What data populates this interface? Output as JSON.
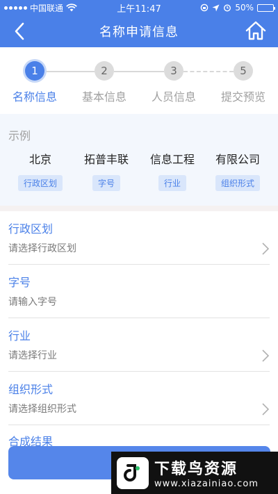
{
  "status_bar": {
    "carrier": "中国联通",
    "time": "上午11:47",
    "battery": "50%",
    "battery_level": 0.5
  },
  "nav": {
    "title": "名称申请信息",
    "back_icon": "chevron-left-icon",
    "home_icon": "home-icon"
  },
  "steps": [
    {
      "number": "1",
      "label": "名称信息",
      "active": true
    },
    {
      "number": "2",
      "label": "基本信息",
      "active": false
    },
    {
      "number": "3",
      "label": "人员信息",
      "active": false
    },
    {
      "number": "5",
      "label": "提交预览",
      "active": false
    }
  ],
  "example": {
    "title": "示例",
    "parts": [
      {
        "word": "北京",
        "tag": "行政区划"
      },
      {
        "word": "拓普丰联",
        "tag": "字号"
      },
      {
        "word": "信息工程",
        "tag": "行业"
      },
      {
        "word": "有限公司",
        "tag": "组织形式"
      }
    ]
  },
  "form": {
    "fields": [
      {
        "label": "行政区划",
        "placeholder": "请选择行政区划",
        "type": "select"
      },
      {
        "label": "字号",
        "placeholder": "请输入字号",
        "type": "input"
      },
      {
        "label": "行业",
        "placeholder": "请选择行业",
        "type": "select"
      },
      {
        "label": "组织形式",
        "placeholder": "请选择组织形式",
        "type": "select"
      }
    ],
    "result_label": "合成结果"
  },
  "watermark": {
    "title": "下载鸟资源",
    "url": "www.xiazainiao.com"
  },
  "colors": {
    "primary": "#4a80e8",
    "inactive": "#a0a0a0",
    "example_bg": "#f3f7fd",
    "tag_bg": "#d9e6fb"
  }
}
